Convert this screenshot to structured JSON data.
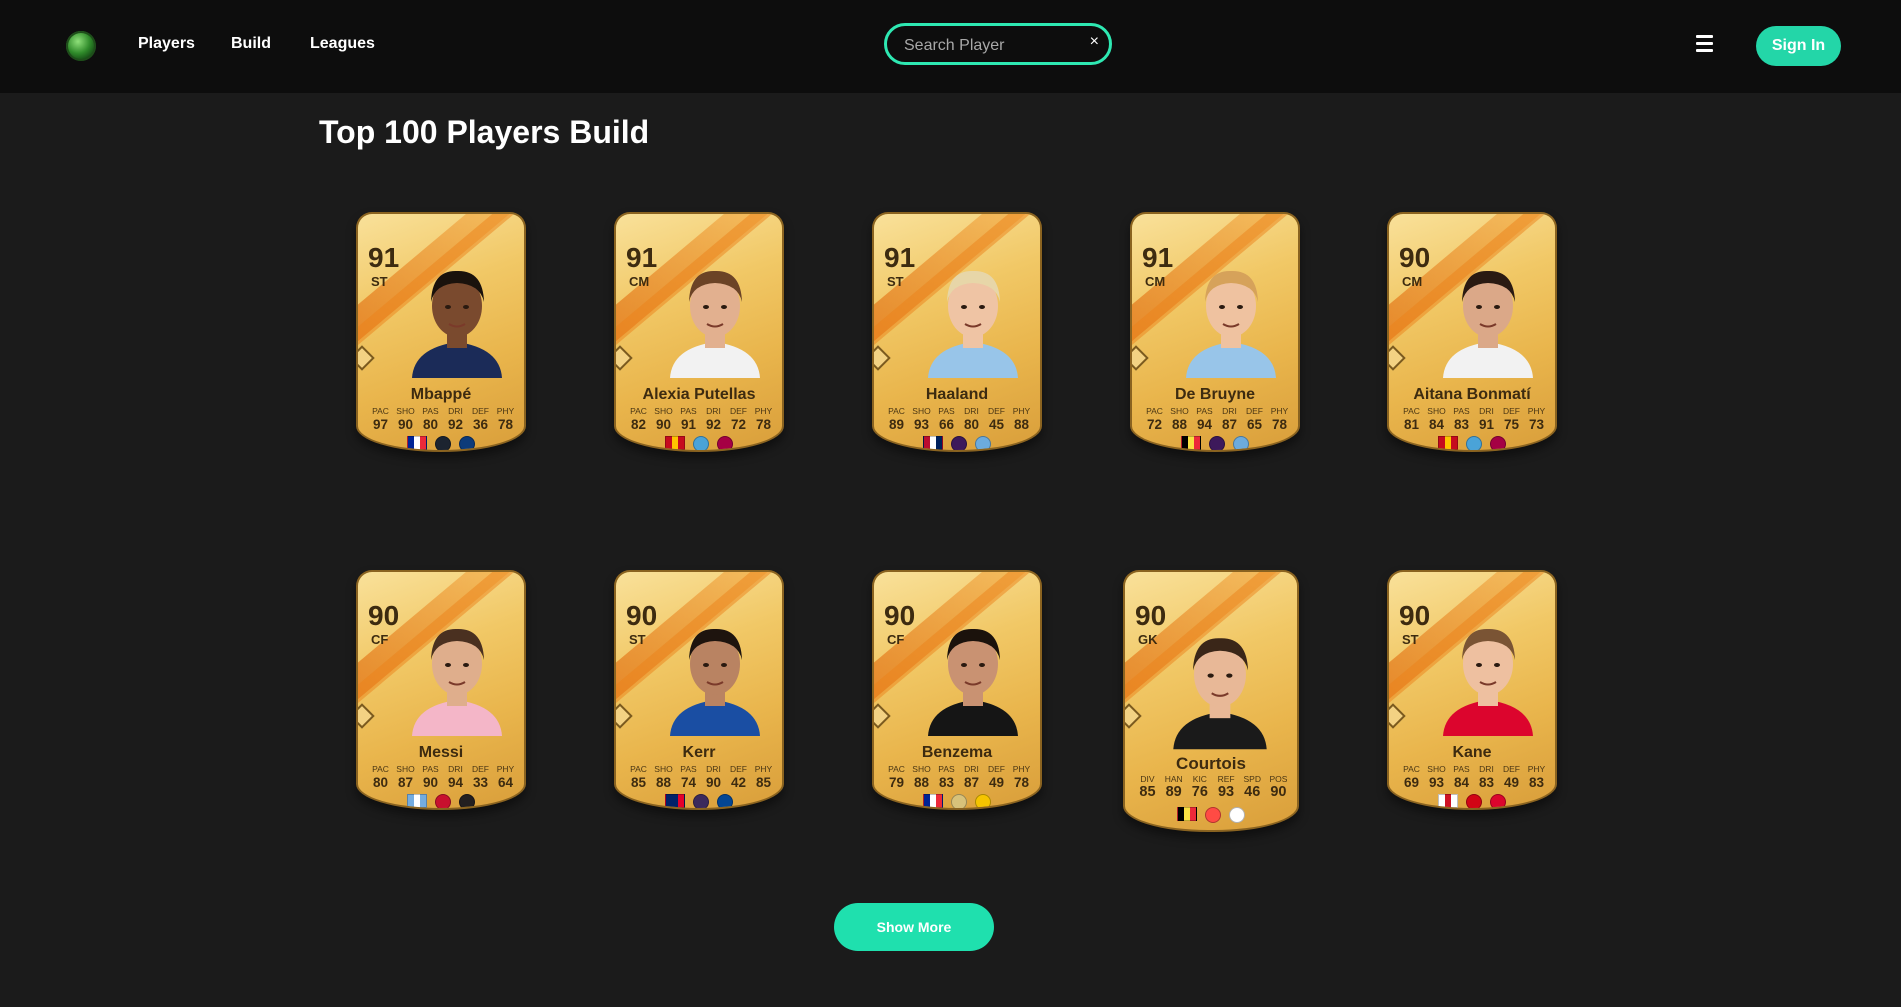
{
  "nav": {
    "links": [
      "Players",
      "Build",
      "Leagues"
    ],
    "search_placeholder": "Search Player",
    "clear_icon": "×",
    "sign_in_label": "Sign In"
  },
  "page": {
    "title": "Top 100 Players Build",
    "show_more_label": "Show More"
  },
  "players": [
    {
      "name": "Mbappé",
      "rating": "91",
      "position": "ST",
      "stat_labels": [
        "PAC",
        "SHO",
        "PAS",
        "DRI",
        "DEF",
        "PHY"
      ],
      "stats": [
        "97",
        "90",
        "80",
        "92",
        "36",
        "78"
      ],
      "skin": "#7a4a2e",
      "hair": "#1a120c",
      "shirt": "#1b2b58",
      "flag": [
        "#002395",
        "#ffffff",
        "#ed2939"
      ],
      "league": "#1c2430",
      "club": "#0d3b7a"
    },
    {
      "name": "Alexia Putellas",
      "rating": "91",
      "position": "CM",
      "stat_labels": [
        "PAC",
        "SHO",
        "PAS",
        "DRI",
        "DEF",
        "PHY"
      ],
      "stats": [
        "82",
        "90",
        "91",
        "92",
        "72",
        "78"
      ],
      "skin": "#e2b08f",
      "hair": "#6b4326",
      "shirt": "#f2f2f2",
      "flag": [
        "#c60b1e",
        "#ffc400",
        "#c60b1e"
      ],
      "league": "#4aa3d8",
      "club": "#a50044"
    },
    {
      "name": "Haaland",
      "rating": "91",
      "position": "ST",
      "stat_labels": [
        "PAC",
        "SHO",
        "PAS",
        "DRI",
        "DEF",
        "PHY"
      ],
      "stats": [
        "89",
        "93",
        "66",
        "80",
        "45",
        "88"
      ],
      "skin": "#efc4a4",
      "hair": "#e7d6a8",
      "shirt": "#98c5e9",
      "flag": [
        "#ba0c2f",
        "#ffffff",
        "#00205b"
      ],
      "league": "#3d195b",
      "club": "#6cabdd"
    },
    {
      "name": "De Bruyne",
      "rating": "91",
      "position": "CM",
      "stat_labels": [
        "PAC",
        "SHO",
        "PAS",
        "DRI",
        "DEF",
        "PHY"
      ],
      "stats": [
        "72",
        "88",
        "94",
        "87",
        "65",
        "78"
      ],
      "skin": "#efc2a0",
      "hair": "#d6a25a",
      "shirt": "#98c5e9",
      "flag": [
        "#000000",
        "#fae042",
        "#ed2939"
      ],
      "league": "#3d195b",
      "club": "#6cabdd"
    },
    {
      "name": "Aitana Bonmatí",
      "rating": "90",
      "position": "CM",
      "stat_labels": [
        "PAC",
        "SHO",
        "PAS",
        "DRI",
        "DEF",
        "PHY"
      ],
      "stats": [
        "81",
        "84",
        "83",
        "91",
        "75",
        "73"
      ],
      "skin": "#dba888",
      "hair": "#2a1a12",
      "shirt": "#f2f2f2",
      "flag": [
        "#c60b1e",
        "#ffc400",
        "#c60b1e"
      ],
      "league": "#4aa3d8",
      "club": "#a50044"
    },
    {
      "name": "Messi",
      "rating": "90",
      "position": "CF",
      "stat_labels": [
        "PAC",
        "SHO",
        "PAS",
        "DRI",
        "DEF",
        "PHY"
      ],
      "stats": [
        "80",
        "87",
        "90",
        "94",
        "33",
        "64"
      ],
      "skin": "#dfae8c",
      "hair": "#4a3020",
      "shirt": "#f4b6c8",
      "flag": [
        "#74acdf",
        "#ffffff",
        "#74acdf"
      ],
      "league": "#c8102e",
      "club": "#231f20"
    },
    {
      "name": "Kerr",
      "rating": "90",
      "position": "ST",
      "stat_labels": [
        "PAC",
        "SHO",
        "PAS",
        "DRI",
        "DEF",
        "PHY"
      ],
      "stats": [
        "85",
        "88",
        "74",
        "90",
        "42",
        "85"
      ],
      "skin": "#b98362",
      "hair": "#1e140e",
      "shirt": "#1a4ea3",
      "flag": [
        "#012169",
        "#012169",
        "#e4002b"
      ],
      "league": "#3c2a5c",
      "club": "#034694"
    },
    {
      "name": "Benzema",
      "rating": "90",
      "position": "CF",
      "stat_labels": [
        "PAC",
        "SHO",
        "PAS",
        "DRI",
        "DEF",
        "PHY"
      ],
      "stats": [
        "79",
        "88",
        "83",
        "87",
        "49",
        "78"
      ],
      "skin": "#c99272",
      "hair": "#1b120c",
      "shirt": "#151515",
      "flag": [
        "#002395",
        "#ffffff",
        "#ed2939"
      ],
      "league": "#d8c27a",
      "club": "#f5c400"
    },
    {
      "name": "Courtois",
      "rating": "90",
      "position": "GK",
      "stat_labels": [
        "DIV",
        "HAN",
        "KIC",
        "REF",
        "SPD",
        "POS"
      ],
      "stats": [
        "85",
        "89",
        "76",
        "93",
        "46",
        "90"
      ],
      "skin": "#e8b897",
      "hair": "#3a2618",
      "shirt": "#1a1a1a",
      "flag": [
        "#000000",
        "#fae042",
        "#ed2939"
      ],
      "league": "#ff4b44",
      "club": "#ffffff"
    },
    {
      "name": "Kane",
      "rating": "90",
      "position": "ST",
      "stat_labels": [
        "PAC",
        "SHO",
        "PAS",
        "DRI",
        "DEF",
        "PHY"
      ],
      "stats": [
        "69",
        "93",
        "84",
        "83",
        "49",
        "83"
      ],
      "skin": "#eec0a0",
      "hair": "#7a5434",
      "shirt": "#dc052d",
      "flag": [
        "#ffffff",
        "#ce1124",
        "#ffffff"
      ],
      "league": "#d20515",
      "club": "#dc052d"
    }
  ]
}
